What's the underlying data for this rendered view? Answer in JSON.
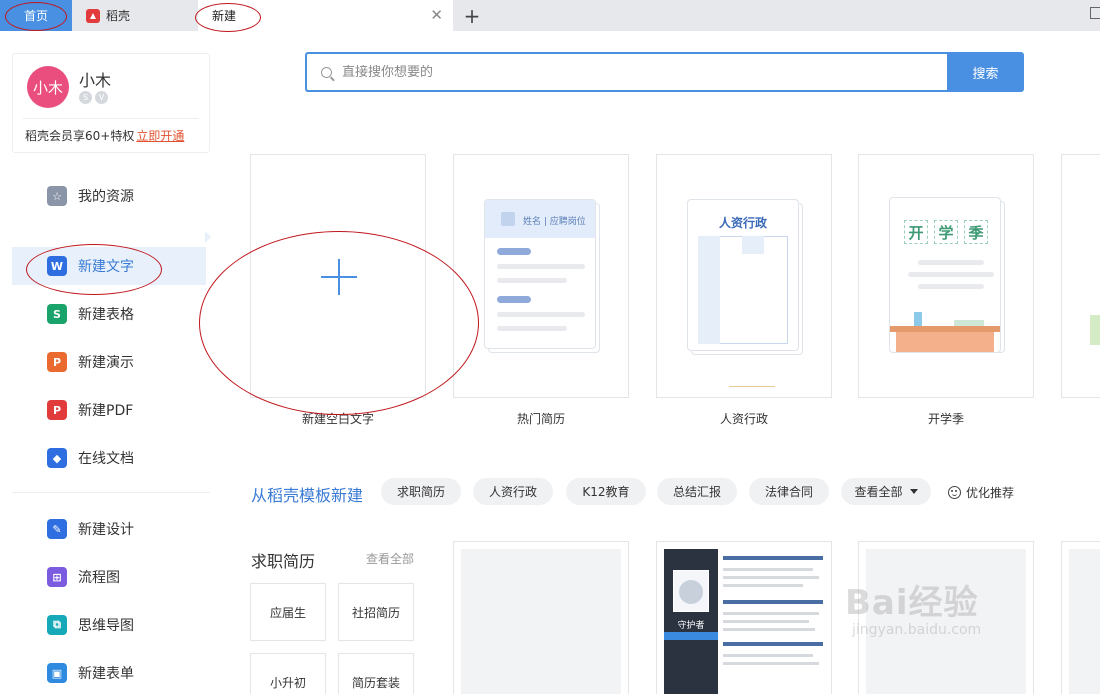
{
  "tabs": {
    "home": "首页",
    "daoke": "稻壳",
    "new": "新建"
  },
  "user": {
    "avatar_text": "小木",
    "name": "小木",
    "vip_text": "稻壳会员享60+特权",
    "vip_link": "立即开通"
  },
  "sidebar": {
    "items": [
      {
        "label": "我的资源",
        "icon": "star-icon",
        "color": "#8a95a8"
      },
      {
        "label": "新建文字",
        "icon": "word-icon",
        "color": "#2f6ee0"
      },
      {
        "label": "新建表格",
        "icon": "sheet-icon",
        "color": "#1aa36a"
      },
      {
        "label": "新建演示",
        "icon": "slides-icon",
        "color": "#ea6a2f"
      },
      {
        "label": "新建PDF",
        "icon": "pdf-icon",
        "color": "#e23b3b"
      },
      {
        "label": "在线文档",
        "icon": "online-doc-icon",
        "color": "#2f6ee0"
      },
      {
        "label": "新建设计",
        "icon": "design-icon",
        "color": "#2f6ee0"
      },
      {
        "label": "流程图",
        "icon": "flowchart-icon",
        "color": "#7b5ce0"
      },
      {
        "label": "思维导图",
        "icon": "mindmap-icon",
        "color": "#16a9b8"
      },
      {
        "label": "新建表单",
        "icon": "form-icon",
        "color": "#2f8ae0"
      }
    ]
  },
  "search": {
    "placeholder": "直接搜你想要的",
    "button": "搜索"
  },
  "templates": {
    "blank": "新建空白文字",
    "resume": "热门简历",
    "hr": "人资行政",
    "school": "开学季",
    "resume_thumb_text": "姓名 | 应聘岗位",
    "hr_thumb_title": "人资行政",
    "school_thumb_chars": [
      "开",
      "学",
      "季"
    ]
  },
  "categories": {
    "title": "从稻壳模板新建",
    "chips": [
      "求职简历",
      "人资行政",
      "K12教育",
      "总结汇报",
      "法律合同",
      "查看全部"
    ],
    "recommend": "优化推荐"
  },
  "resume_section": {
    "title": "求职简历",
    "view_all": "查看全部",
    "tiles": [
      "应届生",
      "社招简历",
      "小升初",
      "简历套装"
    ],
    "sample_name": "守护者"
  },
  "watermark": {
    "main": "Bai经验",
    "sub": "jingyan.baidu.com"
  },
  "colors": {
    "accent": "#4a90e2",
    "annotation": "#c0171c",
    "vip_link": "#e0522f"
  }
}
